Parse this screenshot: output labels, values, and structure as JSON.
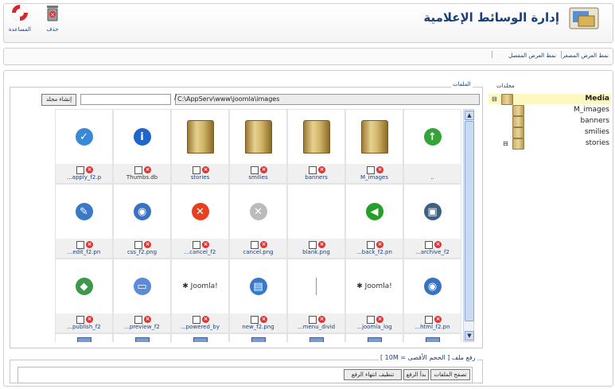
{
  "header": {
    "title": "إدارة الوسائط الإعلامية",
    "toolbar": {
      "help_label": "المساعدة",
      "delete_label": "حذف"
    }
  },
  "subbar": {
    "detail_view": "نمط العرض المفصل",
    "thumb_view": "نمط العرض المصغر"
  },
  "tree": {
    "legend": "مجلدات",
    "items": [
      {
        "label": "Media"
      },
      {
        "label": "M_images"
      },
      {
        "label": "banners"
      },
      {
        "label": "smilies"
      },
      {
        "label": "stories"
      }
    ]
  },
  "files": {
    "legend": "الملفات",
    "path_value": "C:\\AppServ\\www\\joomla\\images",
    "separator": "/",
    "create_folder_label": "إنشاء مجلد",
    "items": [
      {
        "name": "..",
        "icon": "up-arrow-icon",
        "color": "#36a33a"
      },
      {
        "name": "M_images",
        "icon": "folder-icon"
      },
      {
        "name": "banners",
        "icon": "folder-icon"
      },
      {
        "name": "smilies",
        "icon": "folder-icon"
      },
      {
        "name": "stories",
        "icon": "folder-icon"
      },
      {
        "name": "Thumbs.db",
        "icon": "info-icon",
        "color": "#1f66c8"
      },
      {
        "name": "...apply_f2.p",
        "icon": "check-icon",
        "color": "#3a88d8"
      },
      {
        "name": "...archive_f2",
        "icon": "archive-icon",
        "color": "#406080"
      },
      {
        "name": "...back_f2.pn",
        "icon": "back-icon",
        "color": "#24a028"
      },
      {
        "name": "blank.png",
        "icon": "blank-icon"
      },
      {
        "name": "cancel.png",
        "icon": "cancel-gray-icon",
        "color": "#bbbbbb"
      },
      {
        "name": "...cancel_f2",
        "icon": "cancel-red-icon",
        "color": "#e8401f"
      },
      {
        "name": "css_f2.png",
        "icon": "css-icon",
        "color": "#3a72c2"
      },
      {
        "name": "...edit_f2.pn",
        "icon": "edit-icon",
        "color": "#3a78c8"
      },
      {
        "name": "...html_f2.pn",
        "icon": "html-icon",
        "color": "#3a72c2"
      },
      {
        "name": "...joomla_log",
        "icon": "joomla-logo-icon",
        "logo_text": "Joomla!"
      },
      {
        "name": "...menu_divid",
        "icon": "menu-divider-icon"
      },
      {
        "name": "new_f2.png",
        "icon": "new-icon",
        "color": "#3a78c8"
      },
      {
        "name": "...powered_by",
        "icon": "powered-by-icon",
        "logo_text": "Joomla!"
      },
      {
        "name": "...preview_f2",
        "icon": "preview-icon",
        "color": "#5a8ad8"
      },
      {
        "name": "...publish_f2",
        "icon": "publish-icon",
        "color": "#3a9a4a"
      }
    ]
  },
  "upload": {
    "legend": "رفع ملف [ الحجم الأقصى = 10M ]",
    "clear_label": "تنظيف انتهاء الرفع",
    "start_label": "بدأ الرفع",
    "browse_label": "تصفح الملفات"
  }
}
